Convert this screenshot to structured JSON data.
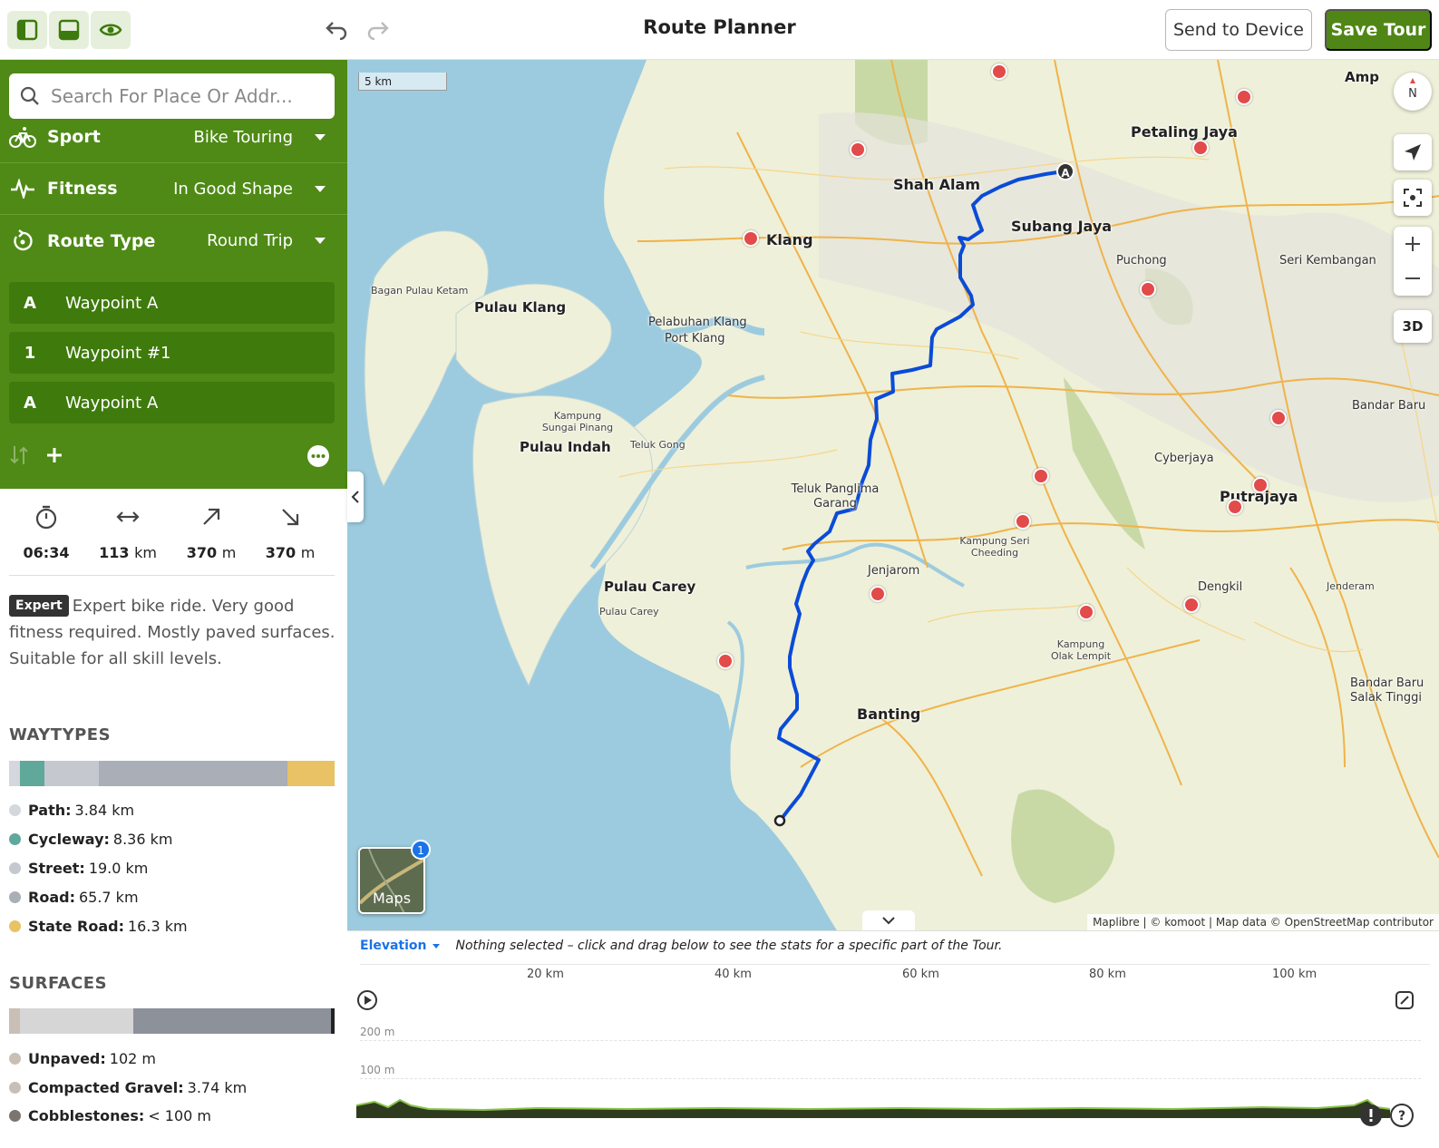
{
  "header": {
    "title": "Route Planner",
    "send_label": "Send to Device",
    "save_label": "Save Tour"
  },
  "search": {
    "placeholder": "Search For Place Or Addr..."
  },
  "options": [
    {
      "label": "Sport",
      "value": "Bike Touring",
      "icon": "bike-icon"
    },
    {
      "label": "Fitness",
      "value": "In Good Shape",
      "icon": "pulse-icon"
    },
    {
      "label": "Route Type",
      "value": "Round Trip",
      "icon": "round-trip-icon"
    }
  ],
  "waypoints": [
    {
      "badge": "A",
      "name": "Waypoint A"
    },
    {
      "badge": "1",
      "name": "Waypoint #1"
    },
    {
      "badge": "A",
      "name": "Waypoint A"
    }
  ],
  "stats": {
    "duration": "06:34",
    "distance": "113",
    "distance_unit": "km",
    "uphill": "370",
    "uphill_unit": "m",
    "downhill": "370",
    "downhill_unit": "m"
  },
  "difficulty": {
    "tag": "Expert",
    "text": "Expert bike ride. Very good fitness required. Mostly paved surfaces. Suitable for all skill levels."
  },
  "waytypes": {
    "title": "WAYTYPES",
    "items": [
      {
        "name": "Path:",
        "value": "3.84 km",
        "color": "#d4d7dc",
        "km": 3.84
      },
      {
        "name": "Cycleway:",
        "value": "8.36 km",
        "color": "#5fa89a",
        "km": 8.36
      },
      {
        "name": "Street:",
        "value": "19.0 km",
        "color": "#c5c9cf",
        "km": 19.0
      },
      {
        "name": "Road:",
        "value": "65.7 km",
        "color": "#a9aeb7",
        "km": 65.7
      },
      {
        "name": "State Road:",
        "value": "16.3 km",
        "color": "#e8c264",
        "km": 16.3
      }
    ]
  },
  "surfaces": {
    "title": "SURFACES",
    "items": [
      {
        "name": "Unpaved:",
        "value": "102 m",
        "color": "#c9bfb4"
      },
      {
        "name": "Compacted Gravel:",
        "value": "3.74 km",
        "color": "#c6bfb8"
      },
      {
        "name": "Cobblestones:",
        "value": "< 100 m",
        "color": "#7a756f"
      }
    ]
  },
  "map": {
    "scale_label": "5 km",
    "maps_label": "Maps",
    "maps_badge": "1",
    "compass_label": "N",
    "btn_3d": "3D",
    "attribution": "Maplibre | © komoot | Map data © OpenStreetMap contributor",
    "start_marker": "A",
    "places_big": [
      "Petaling Jaya",
      "Shah Alam",
      "Subang Jaya",
      "Klang",
      "Pulau Klang",
      "Pulau Indah",
      "Pulau Carey",
      "Banting",
      "Putrajaya",
      "Amp"
    ],
    "places_small": [
      "Puchong",
      "Seri Kembangan",
      "Bagan Pulau Ketam",
      "Pelabuhan Klang",
      "Port Klang",
      "Kampung Sungai Pinang",
      "Teluk Gong",
      "Teluk Panglima Garang",
      "Kampung Seri Cheeding",
      "Jenjarom",
      "Pulau Carey",
      "Dengkil",
      "Jenderam",
      "Cyberjaya",
      "Bandar Baru",
      "Bandar Baru Salak Tinggi",
      "Kampung Olak Lempit"
    ]
  },
  "elevation": {
    "label": "Elevation",
    "note": "Nothing selected – click and drag below to see the stats for a specific part of the Tour.",
    "x_ticks": [
      "20 km",
      "40 km",
      "60 km",
      "80 km",
      "100 km"
    ],
    "y_ticks": [
      "200 m",
      "100 m"
    ]
  }
}
